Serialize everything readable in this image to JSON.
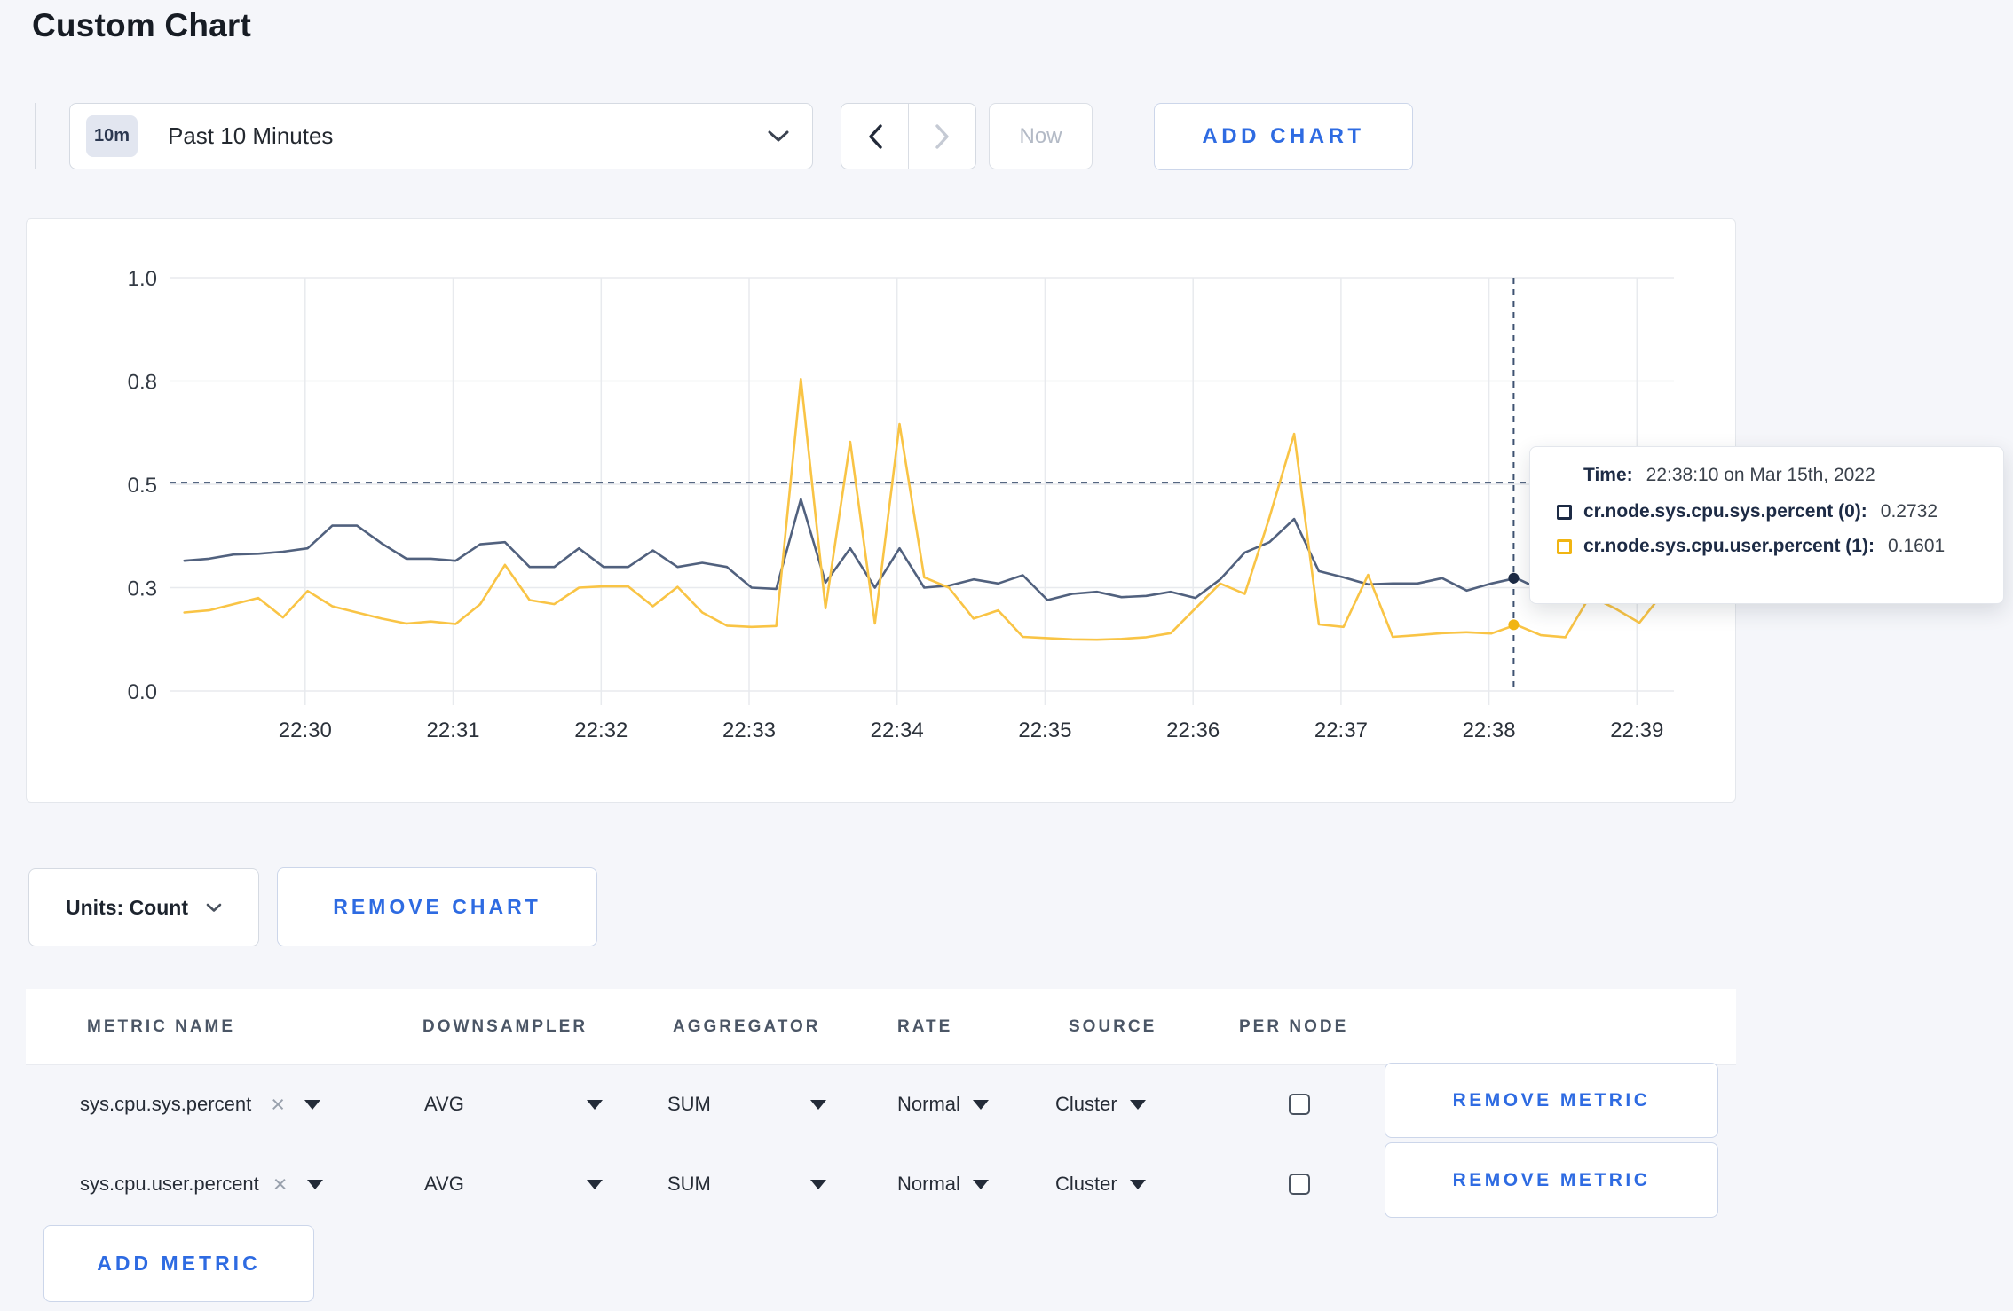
{
  "page": {
    "title": "Custom Chart"
  },
  "theme": {
    "accent_blue": "#2e6be2",
    "page_background": "#f5f6fa",
    "series_sys_color": "#51617e",
    "series_user_color": "#f9c445",
    "grid_color": "#e8eaee"
  },
  "toolbar": {
    "time_range": {
      "badge": "10m",
      "label": "Past 10 Minutes"
    },
    "now_label": "Now",
    "add_chart_label": "ADD CHART"
  },
  "chart_tooltip": {
    "time_label": "Time:",
    "time_value": "22:38:10 on Mar 15th, 2022",
    "rows": [
      {
        "label": "cr.node.sys.cpu.sys.percent (0):",
        "value": "0.2732"
      },
      {
        "label": "cr.node.sys.cpu.user.percent (1):",
        "value": "0.1601"
      }
    ]
  },
  "units": {
    "label": "Units: Count",
    "remove_chart_label": "REMOVE CHART"
  },
  "table": {
    "headers": [
      "METRIC NAME",
      "DOWNSAMPLER",
      "AGGREGATOR",
      "RATE",
      "SOURCE",
      "PER NODE"
    ],
    "rows": [
      {
        "metric": "sys.cpu.sys.percent",
        "downsampler": "AVG",
        "aggregator": "SUM",
        "rate": "Normal",
        "source": "Cluster",
        "per_node_checked": false,
        "remove_label": "REMOVE METRIC"
      },
      {
        "metric": "sys.cpu.user.percent",
        "downsampler": "AVG",
        "aggregator": "SUM",
        "rate": "Normal",
        "source": "Cluster",
        "per_node_checked": false,
        "remove_label": "REMOVE METRIC"
      }
    ],
    "add_metric_label": "ADD METRIC"
  },
  "chart_data": {
    "type": "line",
    "title": "",
    "xlabel": "",
    "ylabel": "",
    "ylim": [
      0,
      1
    ],
    "grid": true,
    "x_axis_start_time": "22:29:05",
    "x_domain_sec": 610,
    "x_start_offset_sec": 6,
    "point_interval_sec": 10,
    "first_point_time": "22:29:11",
    "x_ticks": [
      {
        "t": 55,
        "label": "22:30"
      },
      {
        "t": 115,
        "label": "22:31"
      },
      {
        "t": 175,
        "label": "22:32"
      },
      {
        "t": 235,
        "label": "22:33"
      },
      {
        "t": 295,
        "label": "22:34"
      },
      {
        "t": 355,
        "label": "22:35"
      },
      {
        "t": 415,
        "label": "22:36"
      },
      {
        "t": 475,
        "label": "22:37"
      },
      {
        "t": 535,
        "label": "22:38"
      },
      {
        "t": 595,
        "label": "22:39"
      }
    ],
    "y_ticks": {
      "values": [
        0,
        0.25,
        0.5,
        0.75,
        1.0
      ],
      "labels": [
        "0.0",
        "0.3",
        "0.5",
        "0.8",
        "1.0"
      ]
    },
    "series": [
      {
        "name": "cr.node.sys.cpu.sys.percent",
        "color": "#51617e",
        "swatch": "#1d2b45",
        "values": [
          0.315,
          0.32,
          0.33,
          0.332,
          0.337,
          0.345,
          0.4,
          0.4,
          0.357,
          0.32,
          0.32,
          0.315,
          0.355,
          0.36,
          0.3,
          0.3,
          0.345,
          0.3,
          0.3,
          0.34,
          0.3,
          0.31,
          0.3,
          0.25,
          0.247,
          0.464,
          0.262,
          0.345,
          0.25,
          0.345,
          0.25,
          0.255,
          0.27,
          0.26,
          0.28,
          0.22,
          0.235,
          0.24,
          0.227,
          0.23,
          0.24,
          0.225,
          0.27,
          0.335,
          0.36,
          0.416,
          0.29,
          0.275,
          0.258,
          0.26,
          0.26,
          0.273,
          0.243,
          0.26,
          0.2732,
          0.245,
          0.3,
          0.295,
          0.3,
          0.3,
          0.27
        ]
      },
      {
        "name": "cr.node.sys.cpu.user.percent",
        "color": "#f9c445",
        "swatch": "#f1b512",
        "values": [
          0.19,
          0.195,
          0.21,
          0.225,
          0.178,
          0.242,
          0.205,
          0.19,
          0.175,
          0.163,
          0.168,
          0.162,
          0.21,
          0.305,
          0.22,
          0.21,
          0.25,
          0.253,
          0.253,
          0.205,
          0.252,
          0.19,
          0.158,
          0.155,
          0.157,
          0.755,
          0.2,
          0.603,
          0.163,
          0.646,
          0.275,
          0.25,
          0.175,
          0.195,
          0.131,
          0.128,
          0.125,
          0.124,
          0.126,
          0.13,
          0.14,
          0.2,
          0.26,
          0.235,
          0.42,
          0.622,
          0.161,
          0.155,
          0.281,
          0.131,
          0.135,
          0.14,
          0.142,
          0.139,
          0.1601,
          0.135,
          0.13,
          0.23,
          0.2,
          0.165,
          0.24
        ]
      }
    ],
    "legend_position": "none",
    "hover": {
      "t_sec": 545,
      "time": "22:38:10",
      "guide_value": 0.504,
      "dot_values": [
        0.2732,
        0.1601
      ]
    }
  }
}
